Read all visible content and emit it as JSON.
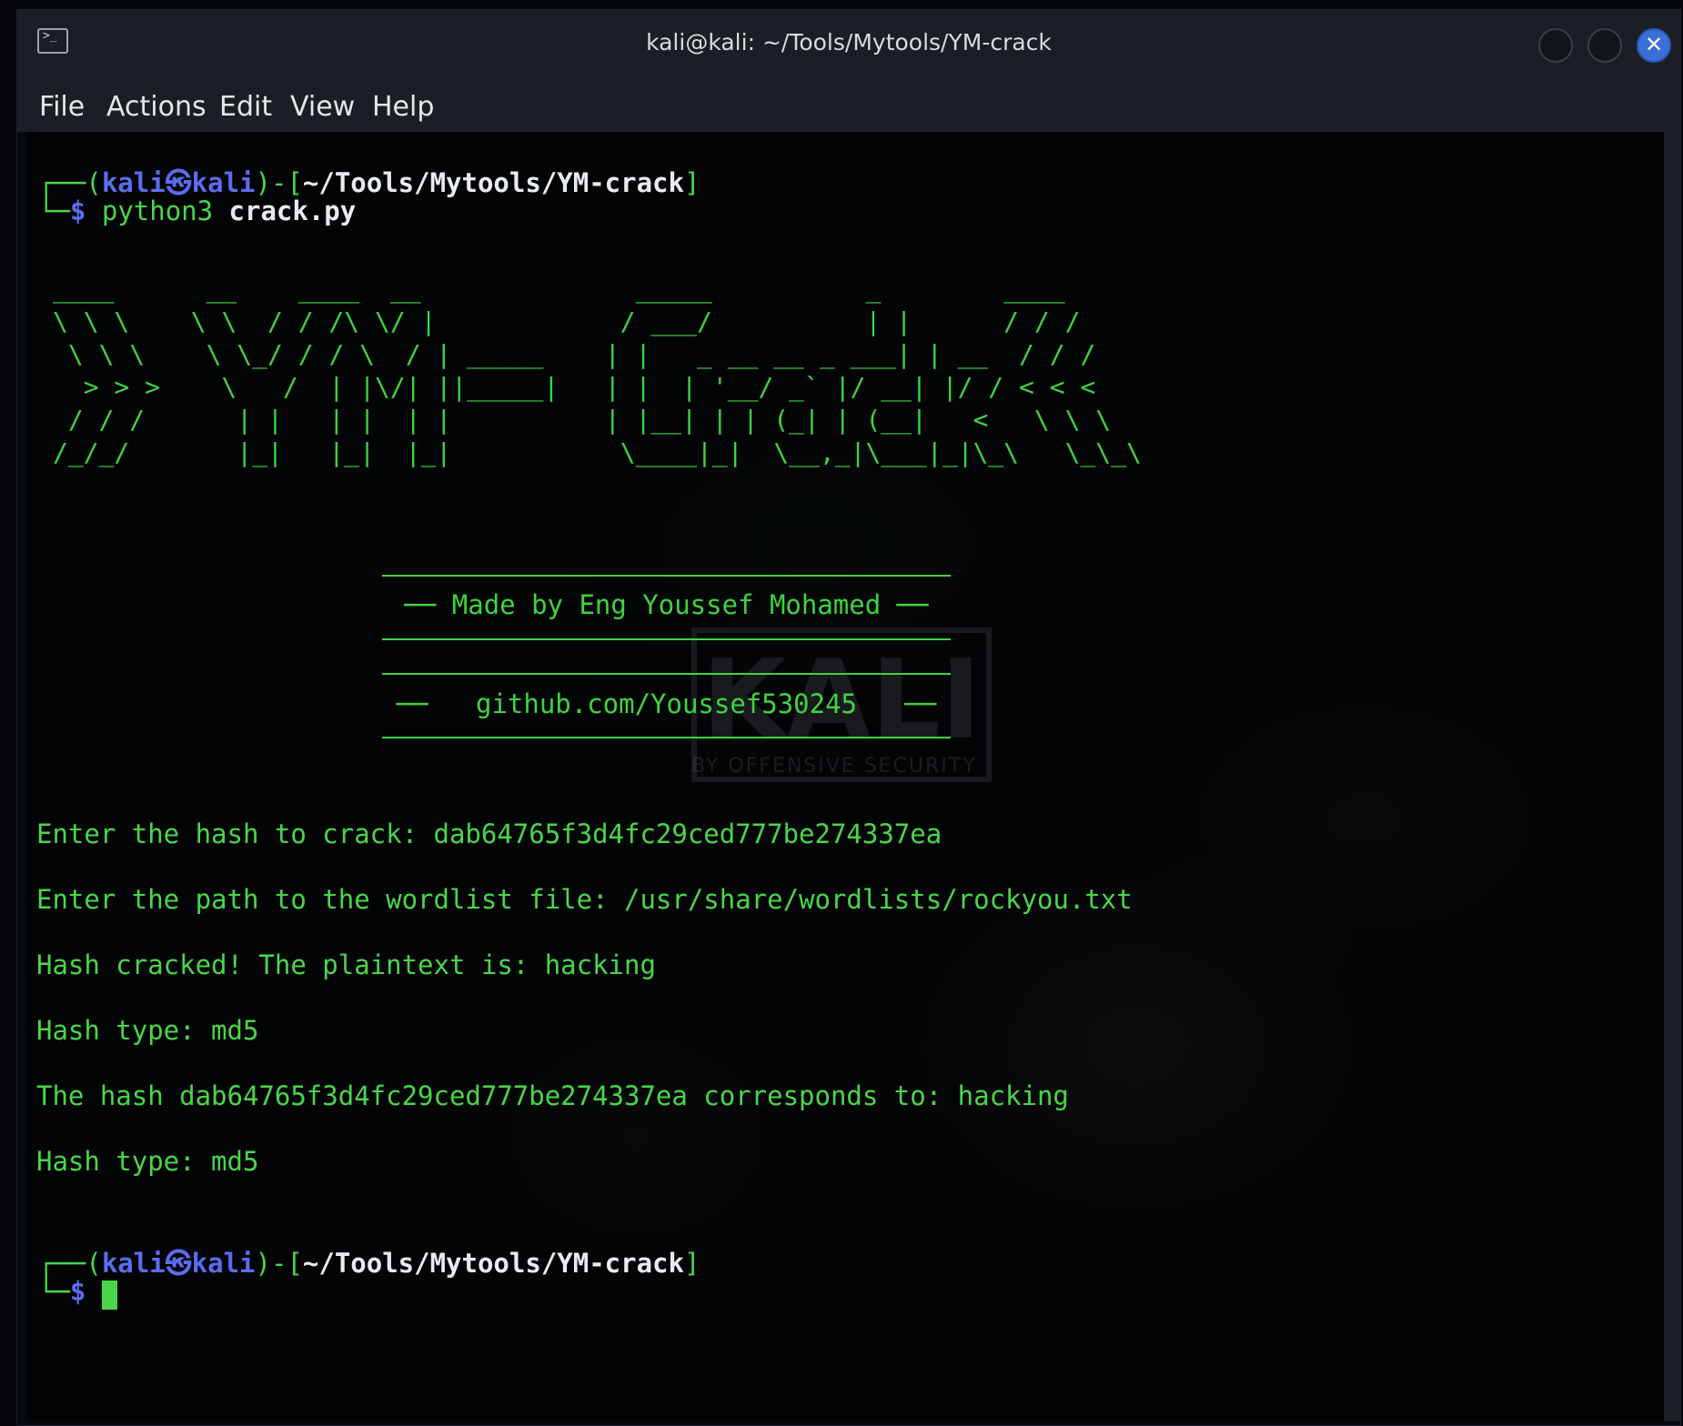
{
  "window": {
    "title": "kali@kali: ~/Tools/Mytools/YM-crack",
    "close_glyph": "✕",
    "app_icon_glyph": ">_"
  },
  "menu": {
    "items": [
      "File",
      "Actions",
      "Edit",
      "View",
      "Help"
    ]
  },
  "prompt": {
    "open": "┌──(",
    "user": "kali㉿kali",
    "mid": ")-[",
    "path": "~/Tools/Mytools/YM-crack",
    "close": "]",
    "corner": "└─",
    "dollar": "$"
  },
  "command": {
    "program": "python3",
    "arg": "crack.py"
  },
  "ascii_banner": "____      __    ____  __              _____          _        ____\n\\ \\ \\    \\ \\  / / /\\ \\/ |            / ___/          | |      / / /\n \\ \\ \\    \\ \\_/ / / \\  / | _____    | |   _ __ __ _ ___| | __  / / / \n  > > >    \\   /  | |\\/| ||_____|   | |  | '__/ _` |/ __| |/ / < < <  \n / / /      | |   | |  | |          | |__| | | (_| | (__|   <   \\ \\ \\ \n/_/_/       |_|   |_|  |_|           \\____|_|  \\__,_|\\___|_|\\_\\   \\_\\_\\",
  "banner": {
    "author_line": "── Made by Eng Youssef Mohamed ──",
    "github_line": "──   github.com/Youssef530245   ──"
  },
  "watermark": {
    "logo": "KALI",
    "sub": "BY OFFENSIVE SECURITY"
  },
  "output": {
    "hash_prompt": "Enter the hash to crack: dab64765f3d4fc29ced777be274337ea",
    "wordlist_prompt": "Enter the path to the wordlist file: /usr/share/wordlists/rockyou.txt",
    "cracked": "Hash cracked! The plaintext is: hacking",
    "hash_type_1": "Hash type: md5",
    "corresponds": "The hash dab64765f3d4fc29ced777be274337ea corresponds to: hacking",
    "hash_type_2": "Hash type: md5"
  },
  "colors": {
    "terminal_green": "#4ad64a",
    "prompt_blue": "#5c6cf0",
    "close_button": "#3b6fd6"
  }
}
